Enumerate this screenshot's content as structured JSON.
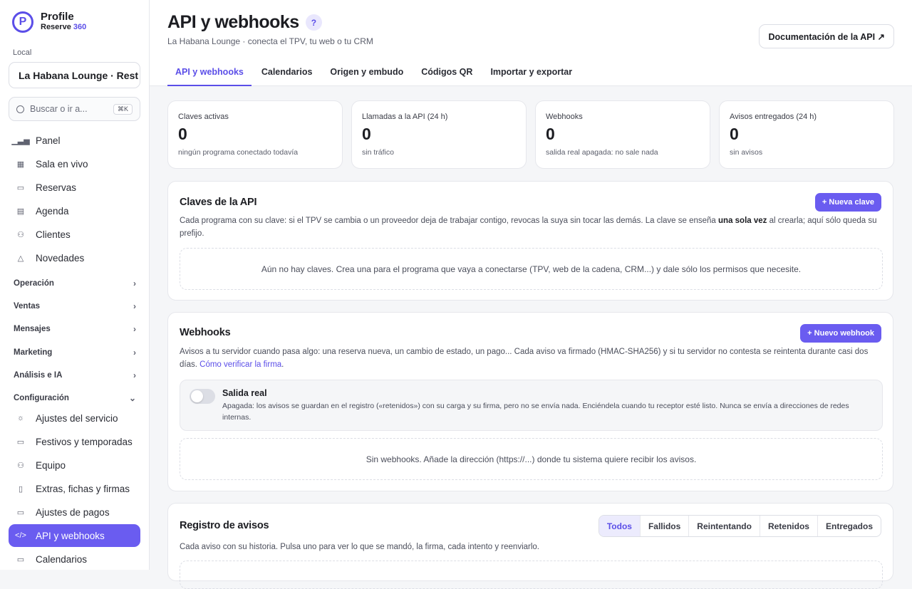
{
  "brand": {
    "name": "Profile",
    "sub_a": "Reserve",
    "sub_b": "360",
    "accent": "#5b4ee8"
  },
  "sidebar": {
    "local_label": "Local",
    "local_value": "La Habana Lounge · Rest",
    "search_placeholder": "Buscar o ir a...",
    "search_shortcut": "⌘K",
    "items": [
      {
        "label": "Panel",
        "icon": "chart-icon"
      },
      {
        "label": "Sala en vivo",
        "icon": "grid-icon"
      },
      {
        "label": "Reservas",
        "icon": "calendar-icon"
      },
      {
        "label": "Agenda",
        "icon": "table-icon"
      },
      {
        "label": "Clientes",
        "icon": "users-icon"
      },
      {
        "label": "Novedades",
        "icon": "bell-icon"
      }
    ],
    "groups": [
      "Operación",
      "Ventas",
      "Mensajes",
      "Marketing",
      "Análisis e IA",
      "Configuración"
    ],
    "config_items": [
      {
        "label": "Ajustes del servicio",
        "icon": "sun-icon"
      },
      {
        "label": "Festivos y temporadas",
        "icon": "calendar-check-icon"
      },
      {
        "label": "Equipo",
        "icon": "team-icon"
      },
      {
        "label": "Extras, fichas y firmas",
        "icon": "document-icon"
      },
      {
        "label": "Ajustes de pagos",
        "icon": "card-icon"
      },
      {
        "label": "API y webhooks",
        "icon": "code-icon"
      },
      {
        "label": "Calendarios",
        "icon": "calendar-icon"
      }
    ]
  },
  "header": {
    "title": "API y webhooks",
    "help": "?",
    "subtitle": "La Habana Lounge · conecta el TPV, tu web o tu CRM",
    "doc_button": "Documentación de la API ↗",
    "tabs": [
      "API y webhooks",
      "Calendarios",
      "Origen y embudo",
      "Códigos QR",
      "Importar y exportar"
    ]
  },
  "stats": [
    {
      "label": "Claves activas",
      "value": "0",
      "sub": "ningún programa conectado todavía"
    },
    {
      "label": "Llamadas a la API (24 h)",
      "value": "0",
      "sub": "sin tráfico"
    },
    {
      "label": "Webhooks",
      "value": "0",
      "sub": "salida real apagada: no sale nada"
    },
    {
      "label": "Avisos entregados (24 h)",
      "value": "0",
      "sub": "sin avisos"
    }
  ],
  "keys": {
    "title": "Claves de la API",
    "button": "+ Nueva clave",
    "desc_a": "Cada programa con su clave: si el TPV se cambia o un proveedor deja de trabajar contigo, revocas la suya sin tocar las demás. La clave se enseña ",
    "desc_b": "una sola vez",
    "desc_c": " al crearla; aquí sólo queda su prefijo.",
    "empty": "Aún no hay claves. Crea una para el programa que vaya a conectarse (TPV, web de la cadena, CRM...) y dale sólo los permisos que necesite."
  },
  "webhooks": {
    "title": "Webhooks",
    "button": "+ Nuevo webhook",
    "desc": "Avisos a tu servidor cuando pasa algo: una reserva nueva, un cambio de estado, un pago... Cada aviso va firmado (HMAC-SHA256) y si tu servidor no contesta se reintenta durante casi dos días. ",
    "link": "Cómo verificar la firma",
    "toggle_title": "Salida real",
    "toggle_on": false,
    "toggle_desc": "Apagada: los avisos se guardan en el registro («retenidos») con su carga y su firma, pero no se envía nada. Enciéndela cuando tu receptor esté listo. Nunca se envía a direcciones de redes internas.",
    "empty": "Sin webhooks. Añade la dirección (https://...) donde tu sistema quiere recibir los avisos."
  },
  "log": {
    "title": "Registro de avisos",
    "desc": "Cada aviso con su historia. Pulsa uno para ver lo que se mandó, la firma, cada intento y reenviarlo.",
    "filters": [
      "Todos",
      "Fallidos",
      "Reintentando",
      "Retenidos",
      "Entregados"
    ]
  }
}
